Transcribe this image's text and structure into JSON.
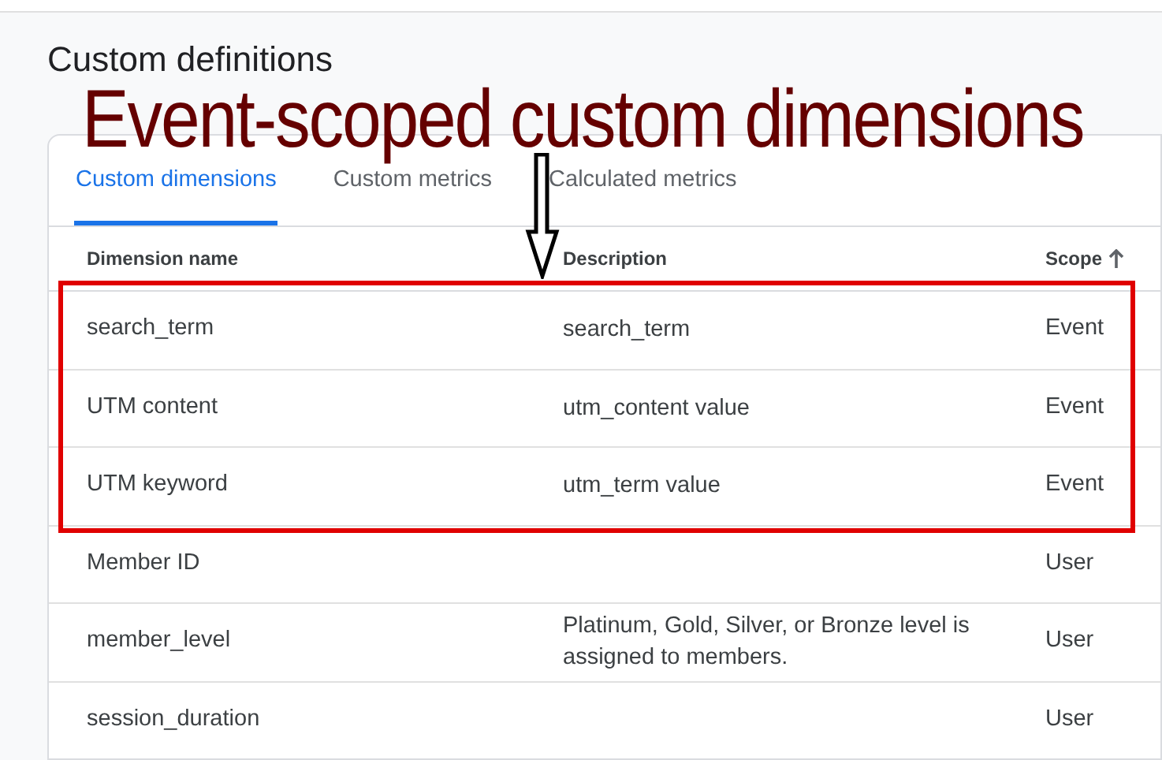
{
  "page": {
    "title": "Custom definitions"
  },
  "annotation": {
    "title": "Event-scoped custom dimensions"
  },
  "tabs": [
    {
      "label": "Custom dimensions",
      "selected": true
    },
    {
      "label": "Custom metrics",
      "selected": false
    },
    {
      "label": "Calculated metrics",
      "selected": false
    }
  ],
  "table": {
    "columns": [
      "Dimension name",
      "Description",
      "Scope"
    ],
    "rows": [
      {
        "name": "search_term",
        "description": "search_term",
        "scope": "Event"
      },
      {
        "name": "UTM content",
        "description": "utm_content value",
        "scope": "Event"
      },
      {
        "name": "UTM keyword",
        "description": "utm_term value",
        "scope": "Event"
      },
      {
        "name": "Member ID",
        "scope": "User"
      },
      {
        "name": "member_level",
        "description": "Platinum, Gold, Silver, or Bronze level is assigned to members.",
        "scope": "User"
      },
      {
        "name": "session_duration",
        "scope": "User"
      }
    ]
  }
}
